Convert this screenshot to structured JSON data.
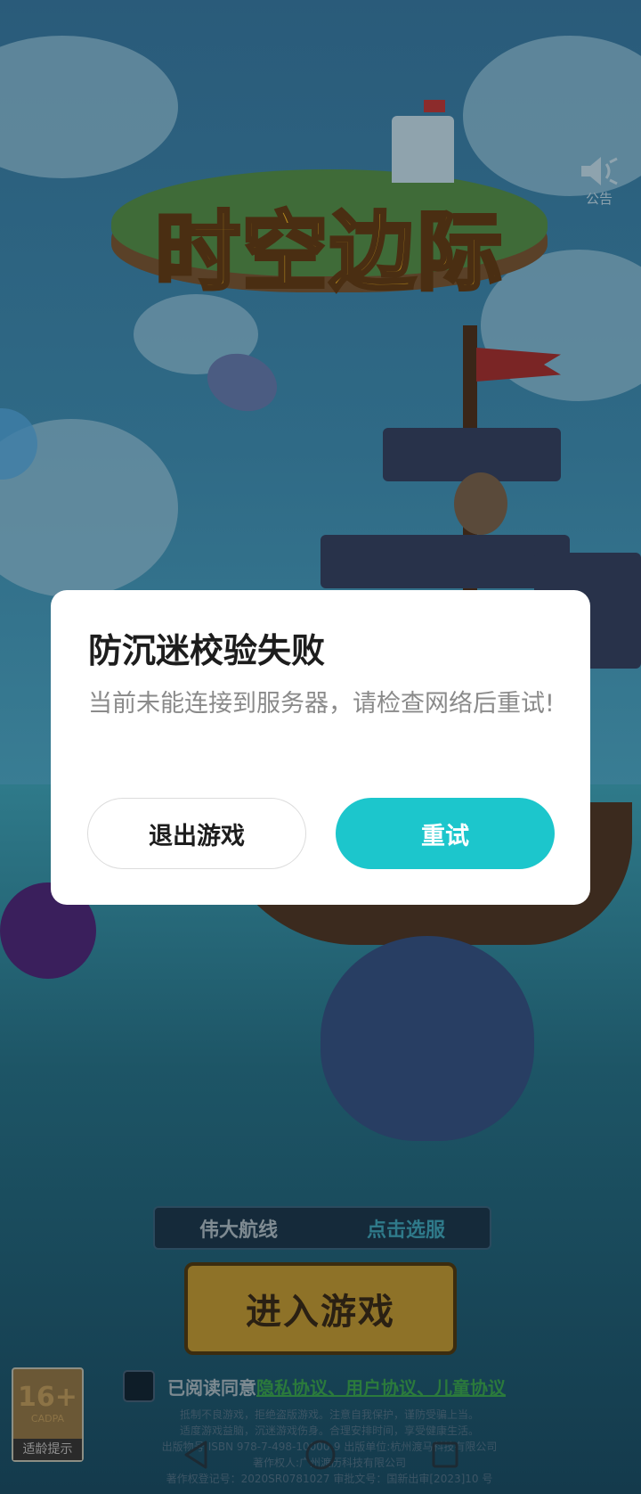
{
  "game": {
    "logo_text": "时空边际",
    "announce_label": "公告",
    "server_name": "伟大航线",
    "server_pick_label": "点击选服",
    "enter_button": "进入游戏",
    "agree_prefix": "已阅读同意",
    "agree_links": "隐私协议、用户协议、儿童协议",
    "notice_line1": "抵制不良游戏，拒绝盗版游戏。注意自我保护，谨防受骗上当。",
    "notice_line2": "适度游戏益脑，沉迷游戏伤身。合理安排时间，享受健康生活。",
    "notice_line3": "出版物号:ISBN 978-7-498-10000-9   出版单位:杭州渡马科技有限公司",
    "notice_line4": "著作权人:广州渡历科技有限公司",
    "notice_line5": "著作权登记号：2020SR0781027   审批文号：国新出审[2023]10 号"
  },
  "age_rating": {
    "number": "16+",
    "org": "CADPA",
    "tip": "适龄提示"
  },
  "dialog": {
    "title": "防沉迷校验失败",
    "message": "当前未能连接到服务器，请检查网络后重试!",
    "exit_button": "退出游戏",
    "retry_button": "重试"
  },
  "colors": {
    "accent": "#1cc6cc",
    "dialog_bg": "#ffffff",
    "link_green": "#2b7a3c"
  },
  "icons": {
    "announce": "speaker-icon",
    "nav_back": "triangle-back-icon",
    "nav_home": "circle-home-icon",
    "nav_recent": "square-recent-icon"
  }
}
